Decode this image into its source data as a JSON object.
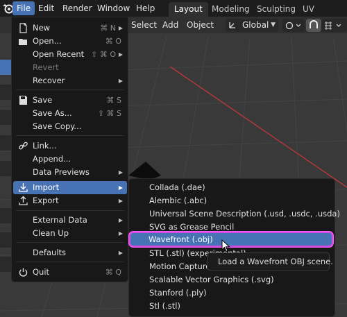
{
  "topbar": {
    "menus": [
      "File",
      "Edit",
      "Render",
      "Window",
      "Help"
    ],
    "workspaces": [
      "Layout",
      "Modeling",
      "Sculpting",
      "UV Editing"
    ],
    "active_workspace": "Layout"
  },
  "viewport_header": {
    "menus": [
      "Select",
      "Add",
      "Object"
    ],
    "transform_orientation": "Global"
  },
  "file_menu": {
    "items": [
      {
        "label": "New",
        "shortcut": "⌘ N",
        "arrow": true,
        "icon": "new-file-icon"
      },
      {
        "label": "Open...",
        "shortcut": "⌘ O",
        "icon": "folder-open-icon"
      },
      {
        "label": "Open Recent",
        "shortcut": "⇧ ⌘ O",
        "arrow": true
      },
      {
        "label": "Revert",
        "disabled": true
      },
      {
        "label": "Recover",
        "arrow": true
      },
      {
        "label": "Save",
        "shortcut": "⌘ S",
        "icon": "save-icon"
      },
      {
        "label": "Save As...",
        "shortcut": "⇧ ⌘ S"
      },
      {
        "label": "Save Copy..."
      },
      {
        "label": "Link...",
        "icon": "link-icon"
      },
      {
        "label": "Append..."
      },
      {
        "label": "Data Previews",
        "arrow": true
      },
      {
        "label": "Import",
        "arrow": true,
        "icon": "import-icon",
        "highlighted": true
      },
      {
        "label": "Export",
        "arrow": true,
        "icon": "export-icon"
      },
      {
        "label": "External Data",
        "arrow": true
      },
      {
        "label": "Clean Up",
        "arrow": true
      },
      {
        "label": "Defaults",
        "arrow": true
      },
      {
        "label": "Quit",
        "shortcut": "⌘ Q",
        "icon": "power-icon"
      }
    ]
  },
  "import_menu": {
    "items": [
      "Collada (.dae)",
      "Alembic (.abc)",
      "Universal Scene Description (.usd, .usdc, .usda)",
      "SVG as Grease Pencil",
      "Wavefront (.obj)",
      "STL (.stl) (experimental)",
      "Motion Capture (",
      "Scalable Vector Graphics (.svg)",
      "Stanford (.ply)",
      "Stl (.stl)"
    ],
    "highlighted_index": 4
  },
  "tooltip": {
    "text": "Load a Wavefront OBJ scene."
  },
  "colors": {
    "accent": "#4772b3",
    "highlight_outline": "#d34be3",
    "menu_bg": "#181818",
    "viewport_bg": "#393939"
  }
}
